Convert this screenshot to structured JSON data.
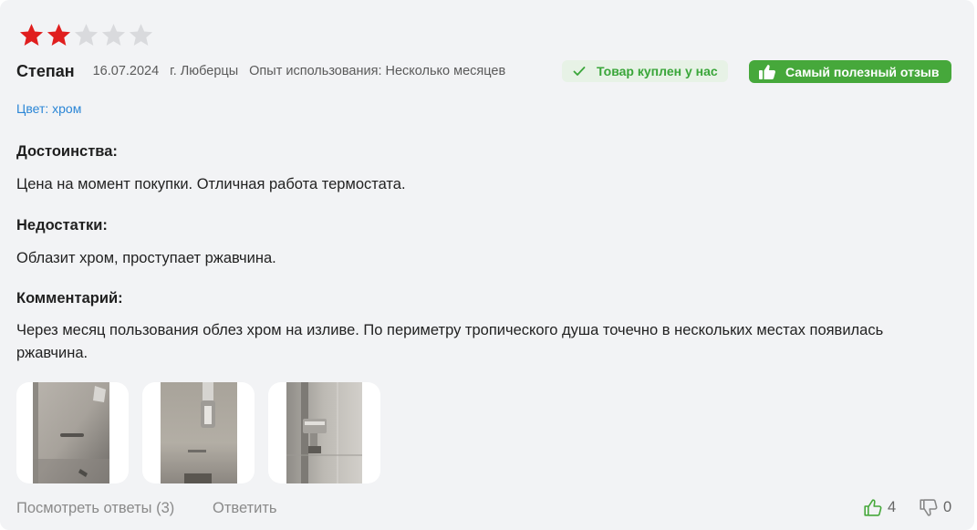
{
  "review": {
    "rating": 2,
    "max_rating": 5,
    "author": "Степан",
    "date": "16.07.2024",
    "city": "г. Люберцы",
    "experience": "Опыт использования: Несколько месяцев",
    "bought_badge": "Товар куплен у нас",
    "useful_badge": "Самый полезный отзыв",
    "color": "Цвет: хром",
    "pros_title": "Достоинства:",
    "pros_text": "Цена на момент покупки. Отличная работа термостата.",
    "cons_title": "Недостатки:",
    "cons_text": "Облазит хром, проступает ржавчина.",
    "comment_title": "Комментарий:",
    "comment_text": "Через месяц пользования облез хром на изливе. По периметру тропического душа точечно в нескольких местах появилась ржавчина.",
    "photos": [
      "photo-1",
      "photo-2",
      "photo-3"
    ]
  },
  "footer": {
    "view_replies": "Посмотреть ответы (3)",
    "reply": "Ответить",
    "likes": "4",
    "dislikes": "0"
  },
  "colors": {
    "star_active": "#e01e1e",
    "star_inactive": "#d9dadd",
    "link": "#2b86d6",
    "green": "#46a83b",
    "bought_bg": "#e7f2e6",
    "card_bg": "#f2f3f5"
  },
  "icons": {
    "bought": "check-icon",
    "useful": "thumbs-up-icon",
    "like": "thumbs-up-outline-icon",
    "dislike": "thumbs-down-outline-icon"
  }
}
